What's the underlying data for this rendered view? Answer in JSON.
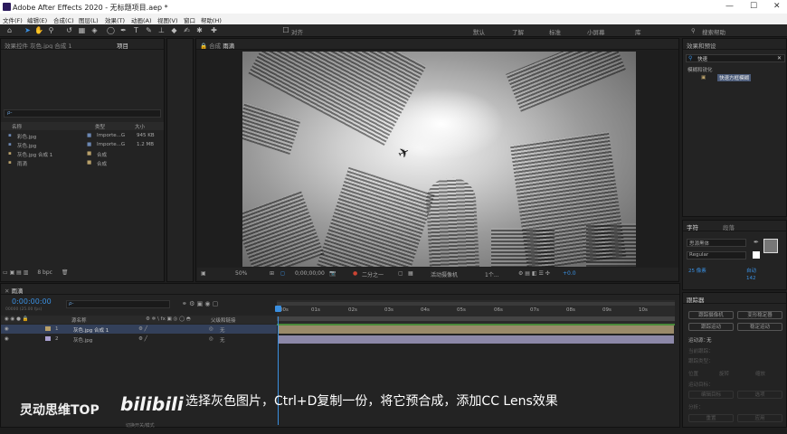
{
  "window": {
    "title": "Adobe After Effects 2020 - 无标题项目.aep *",
    "minimize": "—",
    "maximize": "☐",
    "close": "✕"
  },
  "menu": [
    "文件(F)",
    "编辑(E)",
    "合成(C)",
    "图层(L)",
    "效果(T)",
    "动画(A)",
    "视图(V)",
    "窗口",
    "帮助(H)"
  ],
  "toolbar": {
    "align": "对齐",
    "workspaces": [
      "默认",
      "了解",
      "标准",
      "小屏幕",
      "库"
    ],
    "search_placeholder": "搜索帮助"
  },
  "left_panel": {
    "tab1": "效果控件 灰色.jpg 合成 1",
    "tab2": "项目",
    "search_placeholder": "ρ-",
    "col_name": "名称",
    "col_type": "类型",
    "col_size": "大小",
    "items": [
      {
        "name": "彩色.jpg",
        "type": "Importe...G",
        "size": "945 KB",
        "color": "#6b87b3"
      },
      {
        "name": "灰色.jpg",
        "type": "Importe...G",
        "size": "1.2 MB",
        "color": "#6b87b3"
      },
      {
        "name": "灰色.jpg 合成 1",
        "type": "合成",
        "size": "",
        "color": "#b8a06a"
      },
      {
        "name": "雨滴",
        "type": "合成",
        "size": "",
        "color": "#b8a06a"
      }
    ],
    "bpc": "8 bpc"
  },
  "comp": {
    "tab": "合成",
    "name": "雨滴",
    "zoom": "50%",
    "time": "0;00;00;00",
    "quality": "二分之一",
    "camera": "活动摄像机",
    "views": "1个...",
    "exposure": "+0.0"
  },
  "effects": {
    "title": "效果和预设",
    "search": "快速",
    "category": "模糊和锐化",
    "item": "快速方框模糊"
  },
  "character": {
    "tab1": "字符",
    "tab2": "段落",
    "font": "思源黑体",
    "style": "Regular",
    "size": "25 像素",
    "leading": "自动",
    "tracking": "142"
  },
  "tracker": {
    "title": "跟踪器",
    "buttons": [
      "跟踪摄像机",
      "变形稳定器",
      "跟踪运动",
      "稳定运动"
    ],
    "motion_source": "运动源：",
    "motion_source_val": "无",
    "current_track": "当前跟踪：",
    "track_type": "跟踪类型：",
    "opt1": "位置",
    "opt2": "旋转",
    "opt3": "缩放",
    "target": "运动目标：",
    "edit_target": "编辑目标",
    "options": "选项",
    "analyze": "分析：",
    "reset": "重置",
    "apply": "应用"
  },
  "timeline": {
    "tab": "雨滴",
    "timecode": "0:00:00:00",
    "fps": "00000 (25.00 fps)",
    "col_name": "源名称",
    "col_parent": "父级和链接",
    "ticks": [
      "00s",
      "01s",
      "02s",
      "03s",
      "04s",
      "05s",
      "06s",
      "07s",
      "08s",
      "09s",
      "10s"
    ],
    "layers": [
      {
        "num": "1",
        "name": "灰色.jpg 合成 1",
        "parent": "无",
        "color": "#b8a06a"
      },
      {
        "num": "2",
        "name": "灰色.jpg",
        "parent": "无",
        "color": "#a8a0d0"
      }
    ],
    "mode": "切换开关/模式"
  },
  "overlay": {
    "brand": "灵动思维TOP",
    "logo": "bilibili",
    "subtitle": "选择灰色图片，Ctrl+D复制一份，将它预合成，添加CC Lens效果"
  }
}
